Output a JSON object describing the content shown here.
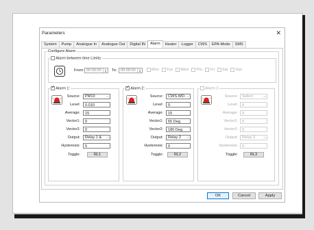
{
  "window": {
    "title": "Parameters",
    "close_glyph": "✕"
  },
  "tabs": [
    {
      "label": "System",
      "active": false
    },
    {
      "label": "Pump",
      "active": false
    },
    {
      "label": "Analogue In",
      "active": false
    },
    {
      "label": "Analogue Out",
      "active": false
    },
    {
      "label": "Digital IN",
      "active": false
    },
    {
      "label": "Alarm",
      "active": true
    },
    {
      "label": "Heater",
      "active": false
    },
    {
      "label": "Logger",
      "active": false
    },
    {
      "label": "CWS",
      "active": false
    },
    {
      "label": "EPA-Mode",
      "active": false
    },
    {
      "label": "SMS",
      "active": false
    }
  ],
  "configure": {
    "label": "Configure Alarm",
    "time_limits_label": "Alarm between time Limits:",
    "time_limits_checked": false,
    "from_label": "From:",
    "from_value": "00:00:00",
    "to_label": "To:",
    "to_value": "00:00:00",
    "days": [
      "Mon",
      "Tue",
      "Wed",
      "Thu",
      "Fri",
      "Sat",
      "Sun"
    ]
  },
  "field_labels": {
    "source": "Source:",
    "level": "Level:",
    "average": "Average:",
    "vector1": "Vector1:",
    "vector2": "Vector2:",
    "output": "Output:",
    "hysteresis": "Hysteresis:",
    "toggle": "Toggle:"
  },
  "alarms": [
    {
      "label": "Alarm 1:",
      "checked": true,
      "enabled": true,
      "source": "PM10",
      "level": "0.010",
      "average": "15",
      "vector1": "0",
      "vector2": "0",
      "output": "Relay 1 &",
      "hysteresis": "5",
      "toggle": "RL1"
    },
    {
      "label": "Alarm 2:",
      "checked": true,
      "enabled": true,
      "source": "CWS.WD-",
      "level": "0",
      "average": "15",
      "vector1": "65 Deg",
      "vector2": "180 Deg",
      "output": "Relay 2",
      "hysteresis": "0",
      "toggle": "RL2"
    },
    {
      "label": "Alarm 3",
      "checked": false,
      "enabled": false,
      "source": "Select",
      "level": "0",
      "average": "0",
      "vector1": "0",
      "vector2": "0",
      "output": "Relay 3",
      "hysteresis": "0",
      "toggle": "RL3"
    }
  ],
  "footer": {
    "ok": "OK",
    "cancel": "Cancel",
    "apply": "Apply"
  },
  "colors": {
    "siren_red": "#d9211e",
    "focus_blue": "#0078d7"
  },
  "icons": {
    "clock": "clock-icon",
    "siren": "siren-icon",
    "dropdown": "chevron-down-icon"
  }
}
